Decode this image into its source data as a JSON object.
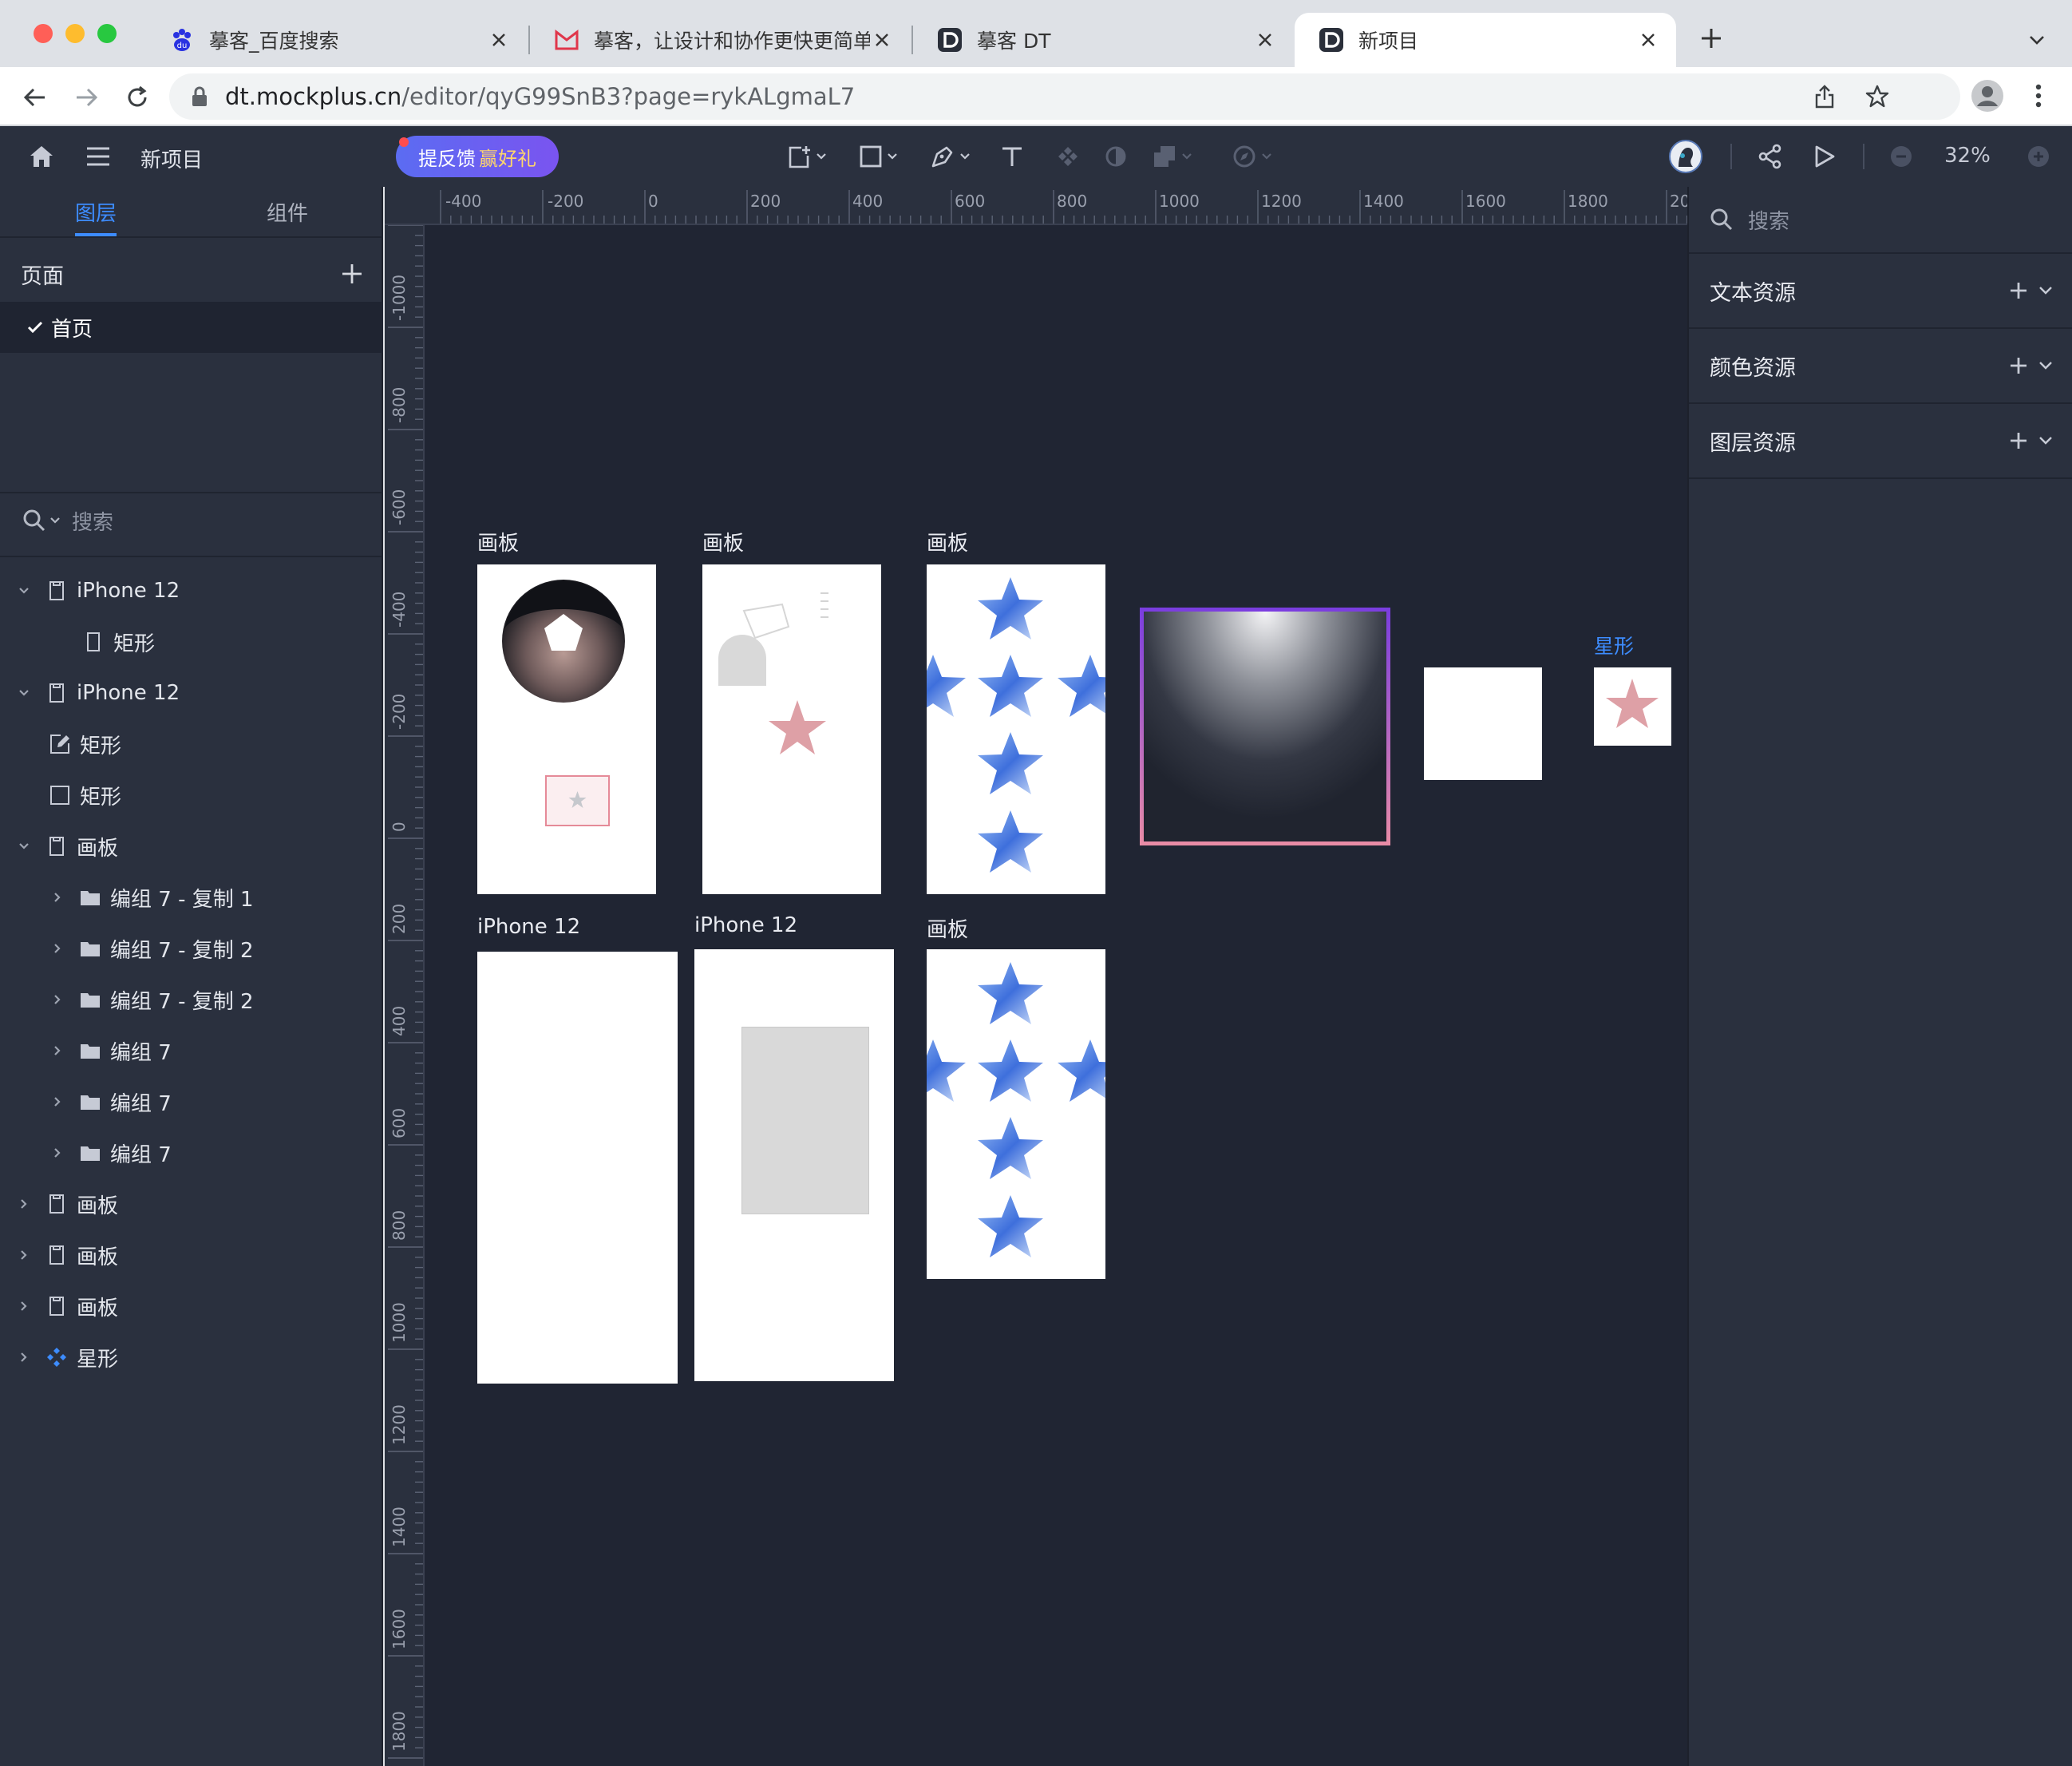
{
  "browser": {
    "tabs": [
      {
        "title": "摹客_百度搜索"
      },
      {
        "title": "摹客，让设计和协作更快更简单"
      },
      {
        "title": "摹客 DT"
      },
      {
        "title": "新项目"
      }
    ],
    "url_host": "dt.mockplus.cn",
    "url_path": "/editor/qyG99SnB3?page=rykALgmaL7"
  },
  "appbar": {
    "project_title": "新项目",
    "feedback_label": "提反馈",
    "feedback_reward": "赢好礼",
    "zoom": "32%"
  },
  "left_panel": {
    "tabs": [
      "图层",
      "组件"
    ],
    "pages_header": "页面",
    "current_page": "首页",
    "search_placeholder": "搜索",
    "layers": [
      {
        "label": "iPhone 12"
      },
      {
        "label": "矩形"
      },
      {
        "label": "iPhone 12"
      },
      {
        "label": "矩形"
      },
      {
        "label": "矩形"
      },
      {
        "label": "画板"
      },
      {
        "label": "编组 7 - 复制 1"
      },
      {
        "label": "编组 7 - 复制 2"
      },
      {
        "label": "编组 7 - 复制 2"
      },
      {
        "label": "编组 7"
      },
      {
        "label": "编组 7"
      },
      {
        "label": "编组 7"
      },
      {
        "label": "画板"
      },
      {
        "label": "画板"
      },
      {
        "label": "画板"
      },
      {
        "label": "星形"
      }
    ]
  },
  "canvas": {
    "h_ruler": [
      "-400",
      "-200",
      "0",
      "200",
      "400",
      "600",
      "800",
      "1000",
      "1200",
      "1400",
      "1600",
      "1800",
      "20"
    ],
    "v_ruler": [
      "-1000",
      "-800",
      "-600",
      "-400",
      "-200",
      "0",
      "200",
      "400",
      "600",
      "800",
      "1000",
      "1200",
      "1400",
      "1600",
      "1800"
    ],
    "artboards": [
      {
        "label": "画板"
      },
      {
        "label": "画板"
      },
      {
        "label": "画板"
      },
      {
        "label": "星形"
      },
      {
        "label": "iPhone 12"
      },
      {
        "label": "iPhone 12"
      },
      {
        "label": "画板"
      }
    ]
  },
  "right_panel": {
    "search_placeholder": "搜索",
    "sections": [
      "文本资源",
      "颜色资源",
      "图层资源"
    ]
  },
  "colors": {
    "accent": "#3d8cff",
    "panel_bg": "#2a303e",
    "canvas_bg": "#202533",
    "star_pink": "#dea0a6",
    "star_blue": "#4f7ee0"
  }
}
